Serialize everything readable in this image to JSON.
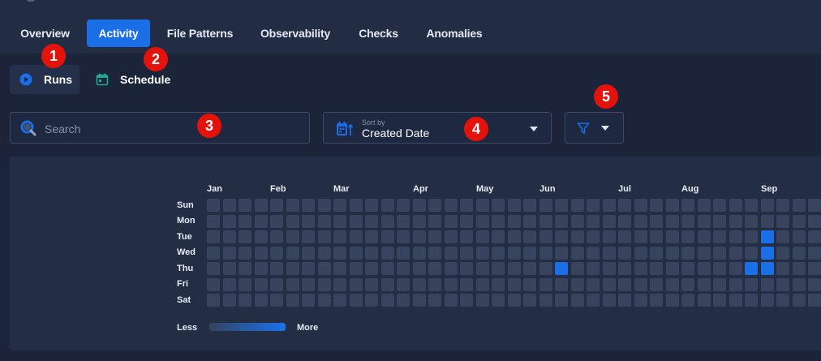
{
  "tabs": [
    {
      "label": "Overview",
      "active": false
    },
    {
      "label": "Activity",
      "active": true
    },
    {
      "label": "File Patterns",
      "active": false
    },
    {
      "label": "Observability",
      "active": false
    },
    {
      "label": "Checks",
      "active": false
    },
    {
      "label": "Anomalies",
      "active": false
    }
  ],
  "subnav": {
    "runs": {
      "label": "Runs",
      "icon": "play-circle-icon",
      "active": true
    },
    "schedule": {
      "label": "Schedule",
      "icon": "calendar-icon",
      "active": false
    }
  },
  "search": {
    "placeholder": "Search",
    "value": "",
    "icon": "search-icon"
  },
  "sort": {
    "caption": "Sort by",
    "value": "Created Date",
    "icon": "calendar-sort-icon"
  },
  "filter": {
    "icon": "filter-icon"
  },
  "heatmap": {
    "months": [
      "Jan",
      "Feb",
      "Mar",
      "Apr",
      "May",
      "Jun",
      "Jul",
      "Aug",
      "Sep"
    ],
    "days": [
      "Sun",
      "Mon",
      "Tue",
      "Wed",
      "Thu",
      "Fri",
      "Sat"
    ],
    "active_cells": [
      {
        "week": 22,
        "day": "Thu",
        "level": 1
      },
      {
        "week": 34,
        "day": "Thu",
        "level": 1
      },
      {
        "week": 35,
        "day": "Tue",
        "level": 1
      },
      {
        "week": 35,
        "day": "Wed",
        "level": 1
      },
      {
        "week": 35,
        "day": "Thu",
        "level": 1
      }
    ],
    "legend": {
      "less": "Less",
      "more": "More"
    }
  },
  "badges": [
    "1",
    "2",
    "3",
    "4",
    "5"
  ],
  "colors": {
    "accent": "#1a6fe6",
    "background": "#1b2438",
    "panel": "#232d44",
    "cell_empty": "#38445d",
    "badge": "#e3120b"
  }
}
